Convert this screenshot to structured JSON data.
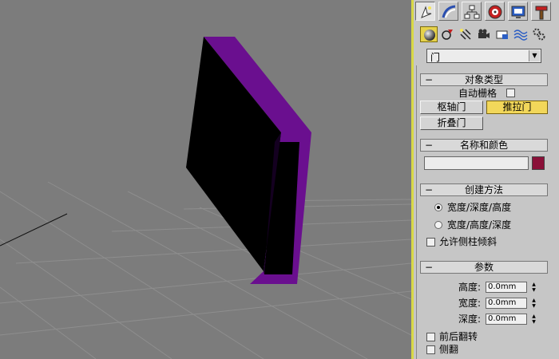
{
  "viewport": {
    "name": "perspective-viewport"
  },
  "panel": {
    "tabs": [
      "create-tab",
      "modify-tab",
      "hierarchy-tab",
      "motion-tab",
      "display-tab",
      "utilities-tab"
    ],
    "subtabs": [
      "geometry",
      "shapes",
      "lights",
      "cameras",
      "helpers",
      "space-warps",
      "systems"
    ],
    "category_dropdown": {
      "value": "门"
    },
    "object_type": {
      "title": "对象类型",
      "autogrid_label": "自动栅格",
      "buttons": {
        "pivot": "枢轴门",
        "sliding": "推拉门",
        "bifold": "折叠门"
      }
    },
    "name_color": {
      "title": "名称和颜色",
      "name_value": "",
      "color": "#8a1038"
    },
    "creation_method": {
      "title": "创建方法",
      "option1": "宽度/深度/高度",
      "option2": "宽度/高度/深度",
      "allow_lean": "允许侧柱倾斜"
    },
    "parameters": {
      "title": "参数",
      "height_label": "高度:",
      "height_value": "0.0mm",
      "width_label": "宽度:",
      "width_value": "0.0mm",
      "depth_label": "深度:",
      "depth_value": "0.0mm",
      "flip_front_back": "前后翻转",
      "flip_side": "侧翻"
    }
  },
  "colors": {
    "viewport_bg": "#7c7c7c",
    "door_face": "#000000",
    "door_edge": "#6a0f8f",
    "panel_bg": "#c6c6c6",
    "highlight": "#e6d24a"
  }
}
